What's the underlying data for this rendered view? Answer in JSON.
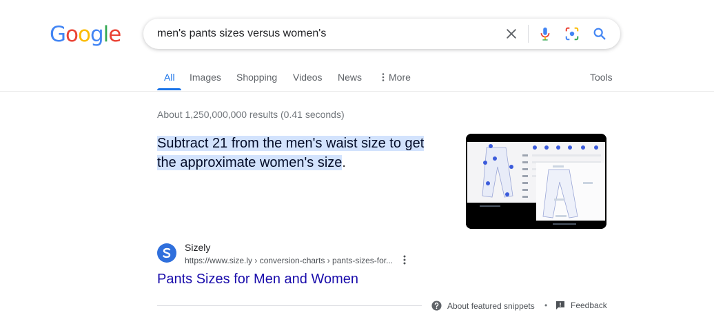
{
  "logo": {
    "letters": [
      "G",
      "o",
      "o",
      "g",
      "l",
      "e"
    ],
    "colors": [
      "#4285F4",
      "#EA4335",
      "#FBBC05",
      "#4285F4",
      "#34A853",
      "#EA4335"
    ]
  },
  "search": {
    "query": "men's pants sizes versus women's"
  },
  "tabs": [
    {
      "label": "All",
      "active": true
    },
    {
      "label": "Images"
    },
    {
      "label": "Shopping"
    },
    {
      "label": "Videos"
    },
    {
      "label": "News"
    },
    {
      "label": "More"
    }
  ],
  "tools_label": "Tools",
  "stats": "About 1,250,000,000 results (0.41 seconds)",
  "snippet": {
    "highlight": "Subtract 21 from the men's waist size to get the approximate women's size",
    "rest": "."
  },
  "source": {
    "site_name": "Sizely",
    "url": "https://www.size.ly › conversion-charts › pants-sizes-for...",
    "favicon_letter": "S"
  },
  "result_title": "Pants Sizes for Men and Women",
  "footer": {
    "about": "About featured snippets",
    "separator": "•",
    "feedback": "Feedback"
  },
  "colors": {
    "accent": "#1a73e8",
    "link": "#1a0dab",
    "highlight": "#d3e3fd"
  }
}
